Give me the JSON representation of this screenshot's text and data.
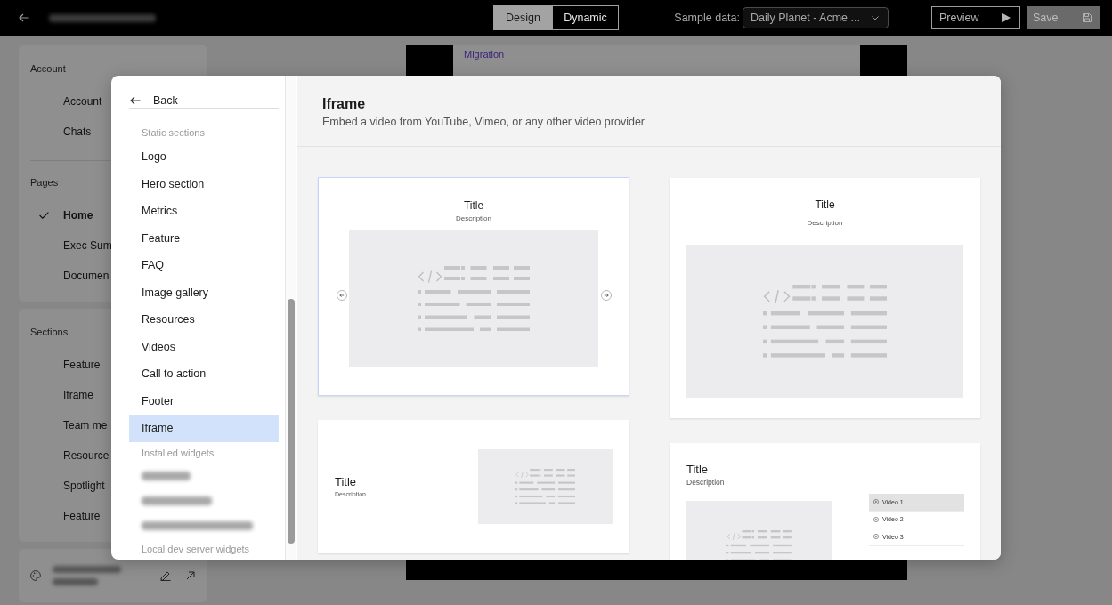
{
  "top_bar": {
    "title": {
      "kind": "blurred"
    },
    "mode_tabs": [
      {
        "label": "Design",
        "selected": true
      },
      {
        "label": "Dynamic",
        "selected": false
      }
    ],
    "sample_data": {
      "label": "Sample data:",
      "value": "Daily Planet - Acme ..."
    },
    "buttons": [
      {
        "kind": "preview",
        "label": "Preview",
        "disabled": false
      },
      {
        "kind": "save",
        "label": "Save",
        "disabled": true
      }
    ]
  },
  "sidebar": {
    "cards": [
      {
        "groups": [
          {
            "heading": "Account",
            "items": [
              {
                "label": "Account"
              },
              {
                "label": "Chats"
              }
            ]
          },
          {
            "heading": "Pages",
            "items": [
              {
                "label": "Home",
                "selected": true
              },
              {
                "label": "Exec Sum",
                "selected": false
              },
              {
                "label": "Documen",
                "selected": false
              }
            ]
          }
        ]
      },
      {
        "groups": [
          {
            "heading": "Sections",
            "items": [
              {
                "label": "Feature"
              },
              {
                "label": "Iframe"
              },
              {
                "label": "Team me"
              },
              {
                "label": "Resource"
              },
              {
                "label": "Spotlight"
              },
              {
                "label": "Feature"
              }
            ]
          }
        ]
      }
    ],
    "site": {
      "name": {
        "kind": "blurred"
      }
    }
  },
  "canvas": {
    "link": "Migration"
  },
  "modal": {
    "back": "Back",
    "groups": [
      {
        "heading": "Static sections",
        "items": [
          {
            "label": "Logo",
            "selected": false
          },
          {
            "label": "Hero section",
            "selected": false
          },
          {
            "label": "Metrics",
            "selected": false
          },
          {
            "label": "Feature",
            "selected": false
          },
          {
            "label": "FAQ",
            "selected": false
          },
          {
            "label": "Image gallery",
            "selected": false
          },
          {
            "label": "Resources",
            "selected": false
          },
          {
            "label": "Videos",
            "selected": false
          },
          {
            "label": "Call to action",
            "selected": false
          },
          {
            "label": "Footer",
            "selected": false
          },
          {
            "label": "Iframe",
            "selected": true
          }
        ]
      },
      {
        "heading": "Installed widgets",
        "items": [
          {
            "kind": "blurred"
          },
          {
            "kind": "blurred"
          },
          {
            "kind": "blurred"
          }
        ]
      },
      {
        "heading": "Local dev server widgets"
      }
    ],
    "title": "Iframe",
    "description": "Embed a video from YouTube, Vimeo, or any other video provider",
    "templates": [
      {
        "kind": "carousel",
        "title": "Title",
        "description": "Description",
        "selected": true
      },
      {
        "kind": "centered",
        "title": "Title",
        "description": "Description",
        "selected": false
      },
      {
        "kind": "split",
        "title": "Title",
        "description": "Description",
        "selected": false
      },
      {
        "kind": "playlist",
        "title": "Title",
        "description": "Description",
        "selected": false,
        "videos": [
          {
            "label": "Video 1",
            "selected": true
          },
          {
            "label": "Video 2",
            "selected": false
          },
          {
            "label": "Video 3",
            "selected": false
          }
        ]
      }
    ]
  }
}
